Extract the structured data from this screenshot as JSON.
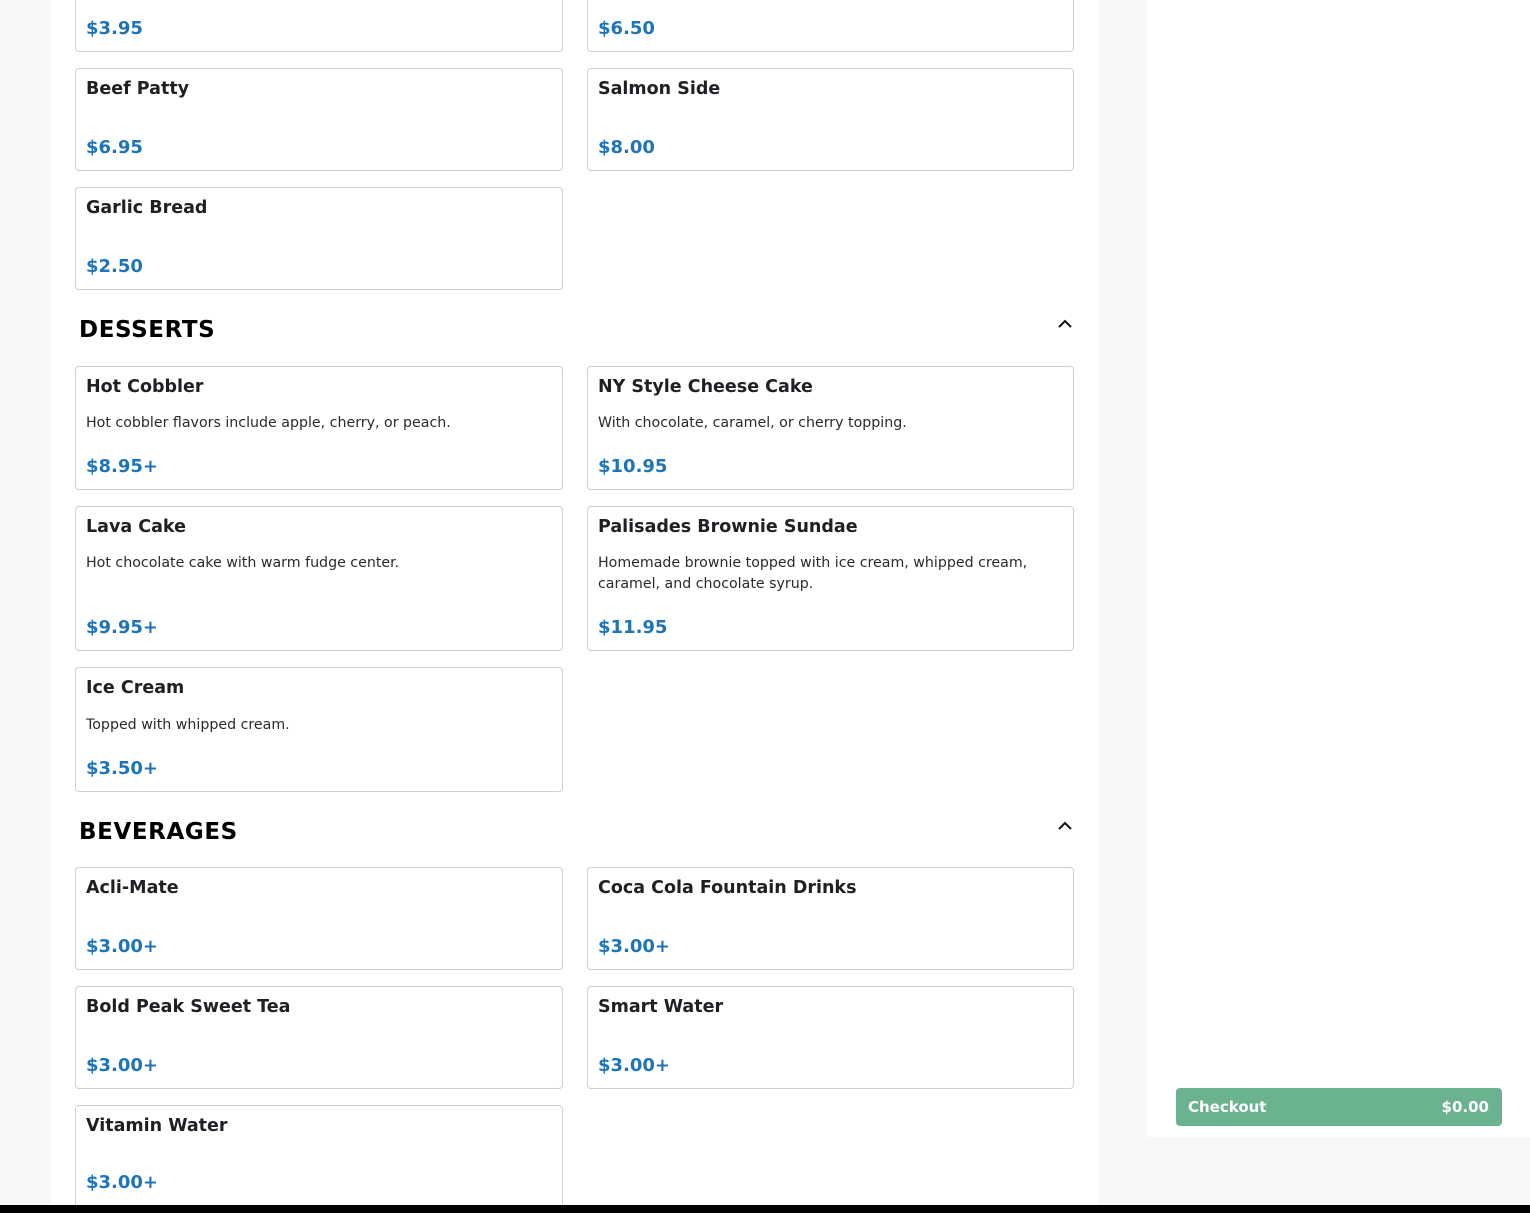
{
  "sides": {
    "items": [
      {
        "title": "",
        "price": "$3.95"
      },
      {
        "title": "",
        "price": "$6.50"
      },
      {
        "title": "Beef Patty",
        "price": "$6.95"
      },
      {
        "title": "Salmon Side",
        "price": "$8.00"
      },
      {
        "title": "Garlic Bread",
        "price": "$2.50"
      }
    ]
  },
  "desserts": {
    "title": "DESSERTS",
    "items": [
      {
        "title": "Hot Cobbler",
        "desc": "Hot cobbler flavors include apple, cherry, or peach.",
        "price": "$8.95+"
      },
      {
        "title": "NY Style Cheese Cake",
        "desc": "With chocolate, caramel, or cherry topping.",
        "price": "$10.95"
      },
      {
        "title": "Lava Cake",
        "desc": "Hot chocolate cake with warm fudge center.",
        "price": "$9.95+"
      },
      {
        "title": "Palisades Brownie Sundae",
        "desc": "Homemade brownie topped with ice cream, whipped cream, caramel, and chocolate syrup.",
        "price": "$11.95"
      },
      {
        "title": "Ice Cream",
        "desc": "Topped with whipped cream.",
        "price": "$3.50+"
      }
    ]
  },
  "beverages": {
    "title": "BEVERAGES",
    "items": [
      {
        "title": "Acli-Mate",
        "price": "$3.00+"
      },
      {
        "title": "Coca Cola Fountain Drinks",
        "price": "$3.00+"
      },
      {
        "title": "Bold Peak Sweet Tea",
        "price": "$3.00+"
      },
      {
        "title": "Smart Water",
        "price": "$3.00+"
      },
      {
        "title": "Vitamin Water",
        "price": "$3.00+"
      }
    ]
  },
  "cart": {
    "checkout_label": "Checkout",
    "total": "$0.00"
  },
  "icons": {
    "collapse": "chevron-up-icon"
  },
  "colors": {
    "price": "#1f74b8",
    "checkout_button": "#6bb28f"
  }
}
